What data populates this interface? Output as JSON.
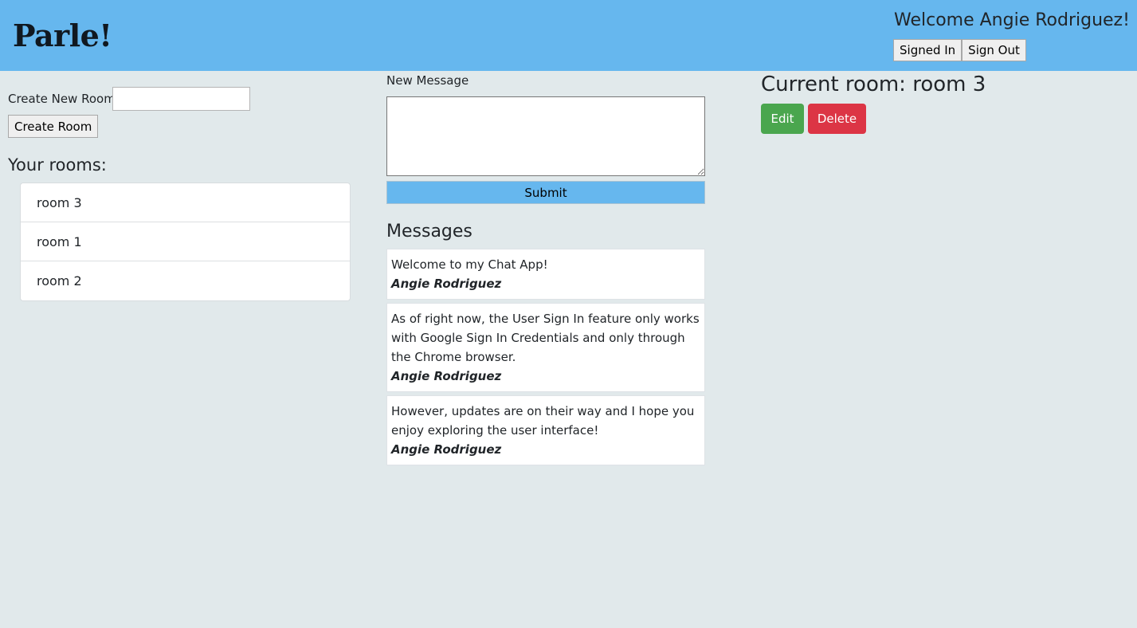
{
  "header": {
    "logo": "Parle!",
    "welcome": "Welcome Angie Rodriguez!",
    "signed_in_label": "Signed In",
    "sign_out_label": "Sign Out"
  },
  "rooms_panel": {
    "create_label": "Create New Room",
    "create_input_value": "",
    "create_button_label": "Create Room",
    "title": "Your rooms:",
    "rooms": [
      "room 3",
      "room 1",
      "room 2"
    ]
  },
  "message_panel": {
    "new_message_label": "New Message",
    "textarea_value": "",
    "submit_label": "Submit",
    "title": "Messages",
    "messages": [
      {
        "text": "Welcome to my Chat App!",
        "author": "Angie Rodriguez"
      },
      {
        "text": "As of right now, the User Sign In feature only works with Google Sign In Credentials and only through the Chrome browser.",
        "author": "Angie Rodriguez"
      },
      {
        "text": "However, updates are on their way and I hope you enjoy exploring the user interface!",
        "author": "Angie Rodriguez"
      }
    ]
  },
  "room_panel": {
    "current_room": "Current room: room 3",
    "edit_label": "Edit",
    "delete_label": "Delete"
  },
  "colors": {
    "header_bg": "#66b7ee",
    "page_bg": "#e1e9eb",
    "edit": "#4aa64e",
    "delete": "#dc3545"
  }
}
